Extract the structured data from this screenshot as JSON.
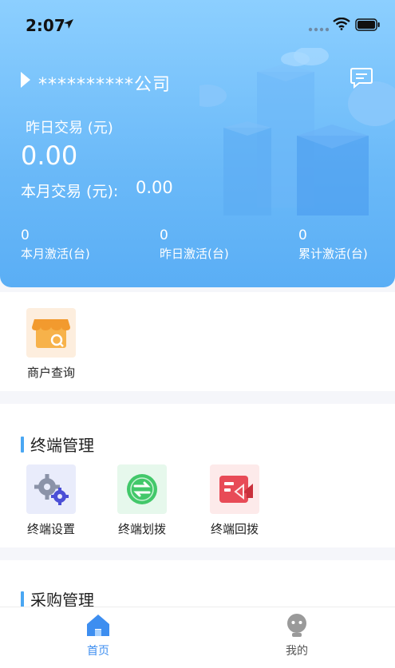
{
  "status_bar": {
    "time": "2:07"
  },
  "header": {
    "company_name": "**********公司",
    "yesterday_label": "昨日交易 (元)",
    "yesterday_value": "0.00",
    "month_label": "本月交易 (元):",
    "month_value": "0.00",
    "stats": [
      {
        "value": "0",
        "label": "本月激活(台)"
      },
      {
        "value": "0",
        "label": "昨日激活(台)"
      },
      {
        "value": "0",
        "label": "累计激活(台)"
      }
    ]
  },
  "quick": {
    "merchant_query": "商户查询"
  },
  "terminal": {
    "title": "终端管理",
    "items": [
      {
        "label": "终端设置"
      },
      {
        "label": "终端划拨"
      },
      {
        "label": "终端回拨"
      }
    ]
  },
  "purchase": {
    "title": "采购管理"
  },
  "tabbar": {
    "home": "首页",
    "mine": "我的",
    "active_color": "#3d8ef0",
    "inactive_color": "#555555"
  },
  "colors": {
    "primary": "#5aaef5",
    "accent_bar": "#4aa7f3"
  }
}
